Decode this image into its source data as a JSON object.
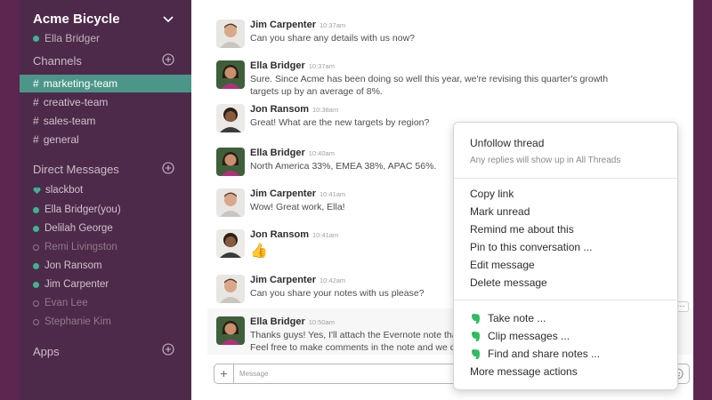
{
  "sidebar": {
    "team_name": "Acme Bicycle",
    "current_user": "Ella Bridger",
    "channels_heading": "Channels",
    "channels": [
      {
        "name": "marketing-team",
        "active": true
      },
      {
        "name": "creative-team",
        "active": false
      },
      {
        "name": "sales-team",
        "active": false
      },
      {
        "name": "general",
        "active": false
      }
    ],
    "dm_heading": "Direct Messages",
    "direct_messages": [
      {
        "name": "slackbot",
        "status": "bot"
      },
      {
        "name": "Ella Bridger(you)",
        "status": "online"
      },
      {
        "name": "Delilah George",
        "status": "online"
      },
      {
        "name": "Remi Livingston",
        "status": "away"
      },
      {
        "name": "Jon Ransom",
        "status": "online"
      },
      {
        "name": "Jim Carpenter",
        "status": "online"
      },
      {
        "name": "Evan Lee",
        "status": "away"
      },
      {
        "name": "Stephanie Kim",
        "status": "away"
      }
    ],
    "apps_heading": "Apps"
  },
  "messages": [
    {
      "author": "Jim Carpenter",
      "time": "10:37am",
      "text": "Can you share any details with us now?"
    },
    {
      "author": "Ella Bridger",
      "time": "10:37am",
      "text": "Sure. Since Acme has been doing so well this year, we're revising this quarter's growth targets up by an average of 8%."
    },
    {
      "author": "Jon Ransom",
      "time": "10:38am",
      "text": "Great! What are the new targets by region?"
    },
    {
      "author": "Ella Bridger",
      "time": "10:40am",
      "text": "North America 33%, EMEA 38%, APAC 56%."
    },
    {
      "author": "Jim Carpenter",
      "time": "10:41am",
      "text": "Wow! Great work, Ella!"
    },
    {
      "author": "Jon Ransom",
      "time": "10:41am",
      "text": "👍"
    },
    {
      "author": "Jim Carpenter",
      "time": "10:42am",
      "text": "Can you share your notes with us please?"
    },
    {
      "author": "Ella Bridger",
      "time": "10:50am",
      "text": "Thanks guys! Yes, I'll attach the Evernote note that ex",
      "text2": "Feel free to make comments in the note and we can"
    }
  ],
  "composer": {
    "placeholder": "Message"
  },
  "menu": {
    "unfollow": "Unfollow thread",
    "unfollow_sub": "Any replies will show up in All Threads",
    "copy_link": "Copy link",
    "mark_unread": "Mark unread",
    "remind": "Remind me about this",
    "pin": "Pin to this conversation ...",
    "edit": "Edit message",
    "delete": "Delete message",
    "take_note": "Take note ...",
    "clip": "Clip messages ...",
    "find_share": "Find and share notes ...",
    "more_actions": "More message actions"
  },
  "colors": {
    "sidebar_bg": "#4e2a4a",
    "active_channel": "#4c9689",
    "online": "#3eb391",
    "evernote_green": "#2dbe60"
  }
}
